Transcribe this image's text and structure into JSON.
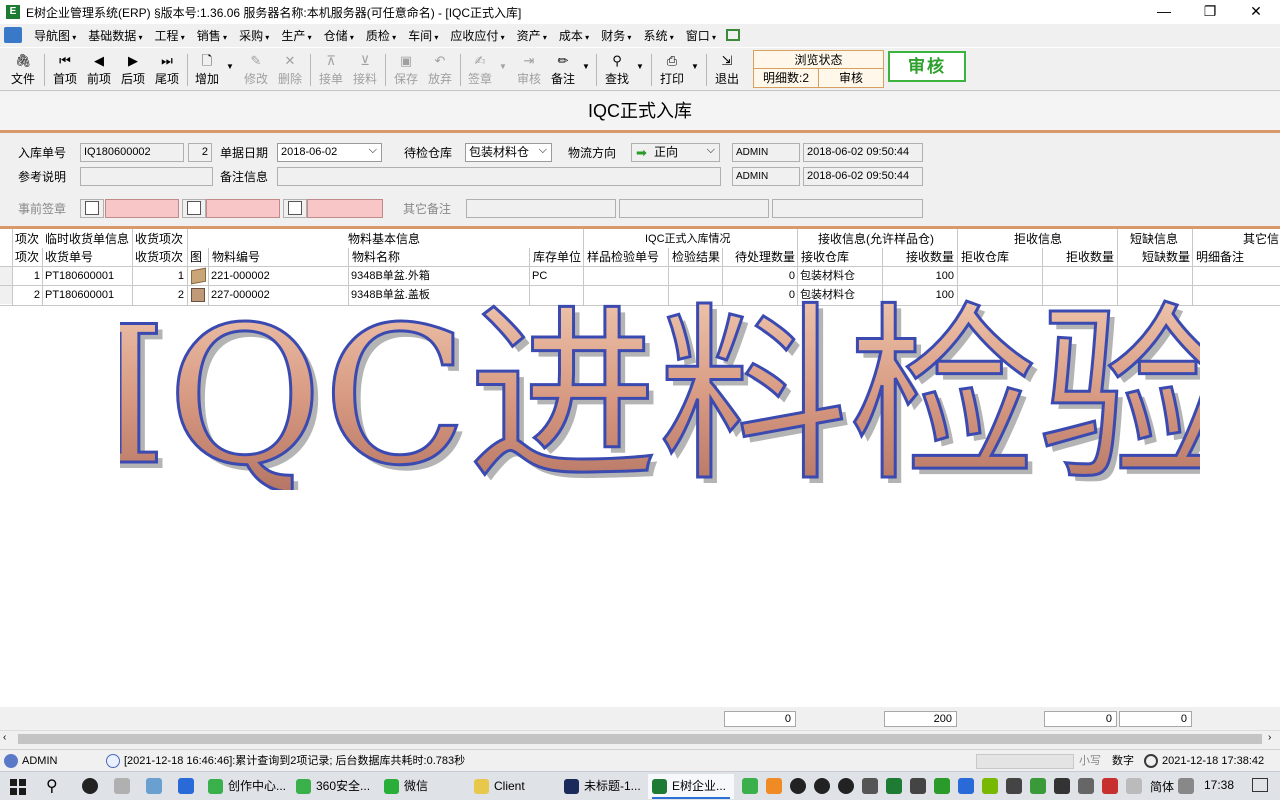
{
  "window": {
    "title": "E树企业管理系统(ERP) §版本号:1.36.06  服务器名称:本机服务器(可任意命名) - [IQC正式入库]",
    "controls": [
      "minimize",
      "restore",
      "close"
    ]
  },
  "menu": [
    "导航图",
    "基础数据",
    "工程",
    "销售",
    "采购",
    "生产",
    "仓储",
    "质检",
    "车间",
    "应收应付",
    "资产",
    "成本",
    "财务",
    "系统",
    "窗口"
  ],
  "toolbar": {
    "buttons": [
      {
        "label": "文件",
        "icon": "paperclip-icon",
        "enabled": true
      },
      {
        "label": "首项",
        "icon": "first-icon",
        "enabled": true
      },
      {
        "label": "前项",
        "icon": "prev-icon",
        "enabled": true
      },
      {
        "label": "后项",
        "icon": "next-icon",
        "enabled": true
      },
      {
        "label": "尾项",
        "icon": "last-icon",
        "enabled": true
      },
      {
        "label": "增加",
        "icon": "new-doc-icon",
        "enabled": true
      },
      {
        "label": "修改",
        "icon": "edit-icon",
        "enabled": false
      },
      {
        "label": "删除",
        "icon": "delete-icon",
        "enabled": false
      },
      {
        "label": "接单",
        "icon": "receive-icon",
        "enabled": false
      },
      {
        "label": "接料",
        "icon": "material-icon",
        "enabled": false
      },
      {
        "label": "保存",
        "icon": "save-icon",
        "enabled": false
      },
      {
        "label": "放弃",
        "icon": "undo-icon",
        "enabled": false
      },
      {
        "label": "签章",
        "icon": "stamp-icon",
        "enabled": false
      },
      {
        "label": "审核",
        "icon": "audit-icon",
        "enabled": false
      },
      {
        "label": "备注",
        "icon": "note-icon",
        "enabled": true
      },
      {
        "label": "查找",
        "icon": "binoculars-icon",
        "enabled": true
      },
      {
        "label": "打印",
        "icon": "printer-icon",
        "enabled": true
      },
      {
        "label": "退出",
        "icon": "exit-icon",
        "enabled": true
      }
    ],
    "view_state": {
      "title": "浏览状态",
      "detail_count": "明细数:2",
      "status": "审核"
    },
    "audit_stamp": "审核"
  },
  "form": {
    "title": "IQC正式入库",
    "fields": {
      "receipt_no": {
        "label": "入库单号",
        "value": "IQ180600002",
        "suffix": "2"
      },
      "doc_date": {
        "label": "单据日期",
        "value": "2018-06-02"
      },
      "pending_warehouse": {
        "label": "待检仓库",
        "value": "包装材料仓"
      },
      "flow_direction": {
        "label": "物流方向",
        "value": "正向"
      },
      "creator": "ADMIN",
      "created_at": "2018-06-02 09:50:44",
      "modifier": "ADMIN",
      "modified_at": "2018-06-02 09:50:44",
      "ref_desc": {
        "label": "参考说明",
        "value": ""
      },
      "remark": {
        "label": "备注信息",
        "value": ""
      },
      "pre_sign": {
        "label": "事前签章"
      },
      "other_remark": {
        "label": "其它备注"
      }
    }
  },
  "grid": {
    "group_headers": [
      "项次",
      "临时收货单信息",
      "收货项次",
      "物料基本信息",
      "IQC正式入库情况",
      "接收信息(允许样品仓)",
      "拒收信息",
      "短缺信息",
      "其它信"
    ],
    "columns": [
      "项次",
      "收货单号",
      "收货项次",
      "图",
      "物料编号",
      "物料名称",
      "库存单位",
      "样品检验单号",
      "检验结果",
      "待处理数量",
      "接收仓库",
      "接收数量",
      "拒收仓库",
      "拒收数量",
      "短缺数量",
      "明细备注"
    ],
    "rows": [
      {
        "seq": "1",
        "receipt_no": "PT180600001",
        "receipt_seq": "1",
        "item_code": "221-000002",
        "item_name": "9348B单盆.外箱",
        "unit": "PC",
        "sample_no": "",
        "result": "",
        "pending_qty": "0",
        "accept_wh": "包装材料仓",
        "accept_qty": "100",
        "reject_wh": "",
        "reject_qty": "",
        "short_qty": "",
        "remark": ""
      },
      {
        "seq": "2",
        "receipt_no": "PT180600001",
        "receipt_seq": "2",
        "item_code": "227-000002",
        "item_name": "9348B单盆.盖板",
        "unit": "",
        "sample_no": "",
        "result": "",
        "pending_qty": "0",
        "accept_wh": "包装材料仓",
        "accept_qty": "100",
        "reject_wh": "",
        "reject_qty": "",
        "short_qty": "",
        "remark": ""
      }
    ],
    "totals": {
      "pending_qty": "0",
      "accept_qty": "200",
      "reject_qty": "0",
      "short_qty": "0"
    }
  },
  "overlay_text": "IQC进料检验",
  "statusbar": {
    "user": "ADMIN",
    "message": "[2021-12-18 16:46:46]:累计查询到2项记录; 后台数据库共耗时:0.783秒",
    "small_caps": "小写",
    "num_mode": "数字",
    "clock": "2021-12-18  17:38:42"
  },
  "taskbar": {
    "apps": [
      "创作中心...",
      "360安全...",
      "微信",
      "Client",
      "未标题-1...",
      "E树企业..."
    ],
    "ime": "简体",
    "time": "17:38"
  }
}
